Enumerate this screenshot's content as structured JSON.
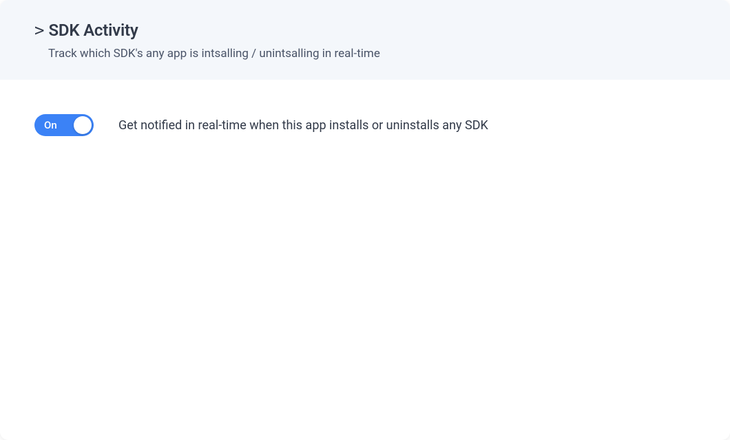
{
  "header": {
    "chevron": ">",
    "title": "SDK Activity",
    "subtitle": "Track which SDK's any app is intsalling / unintsalling in real-time"
  },
  "toggle": {
    "state_label": "On",
    "description": "Get notified in real-time when this app installs or uninstalls any SDK"
  }
}
